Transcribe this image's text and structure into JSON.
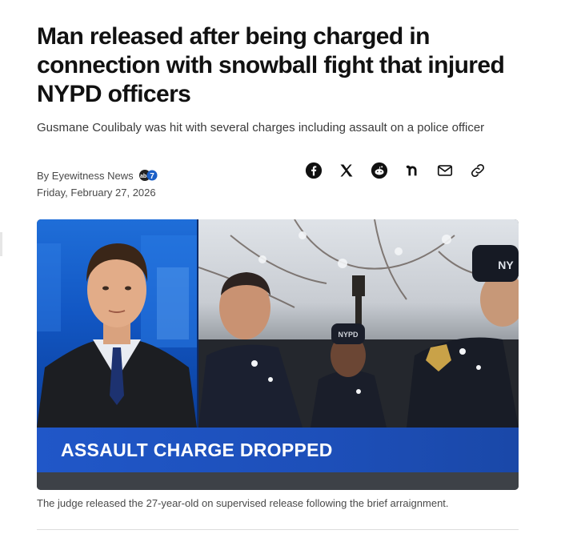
{
  "article": {
    "headline": "Man released after being charged in connection with snowball fight that injured NYPD officers",
    "subheadline": "Gusmane Coulibaly was hit with several charges including assault on a police officer",
    "byline": "By Eyewitness News",
    "date": "Friday, February 27, 2026",
    "caption": "The judge released the 27-year-old on supervised release following the brief arraignment."
  },
  "share": {
    "icons": [
      "facebook-icon",
      "x-icon",
      "reddit-icon",
      "nextdoor-icon",
      "email-icon",
      "link-icon"
    ]
  },
  "media": {
    "banner_text": "ASSAULT CHARGE DROPPED",
    "cap_text_1": "NY",
    "cap_text_2": "NYPD"
  },
  "colors": {
    "headline": "#111111",
    "banner_blue": "#1d4fb9",
    "anchor_bg_blue": "#1a63cf",
    "muted_text": "#4a4a4a",
    "logo_blue": "#1a5fc7"
  }
}
